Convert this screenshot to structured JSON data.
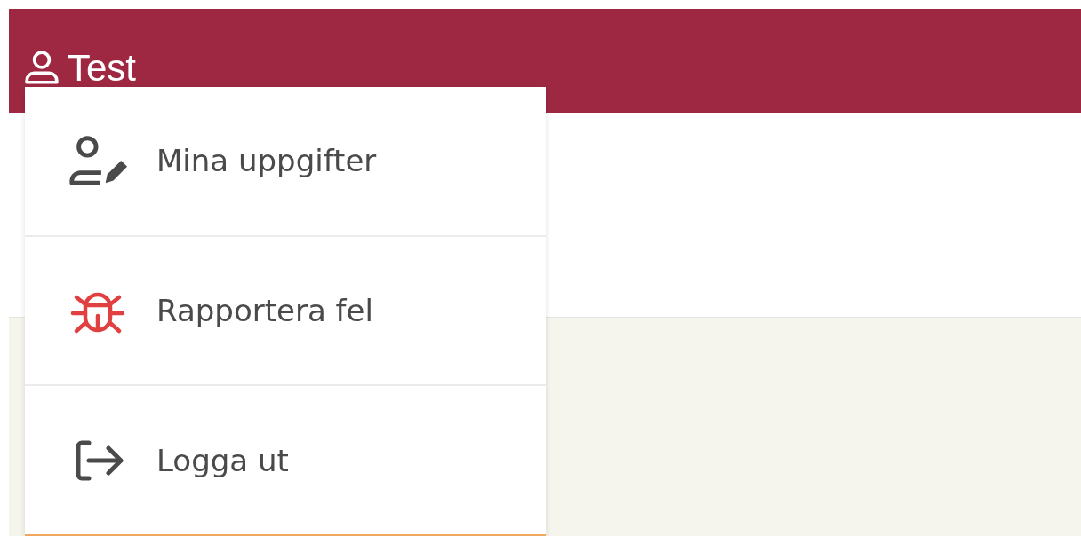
{
  "header": {
    "user_name": "Test"
  },
  "user_menu": {
    "items": [
      {
        "kind": "profile",
        "label": "Mina uppgifter"
      },
      {
        "kind": "bug",
        "label": "Rapportera fel"
      },
      {
        "kind": "logout",
        "label": "Logga ut"
      }
    ]
  }
}
